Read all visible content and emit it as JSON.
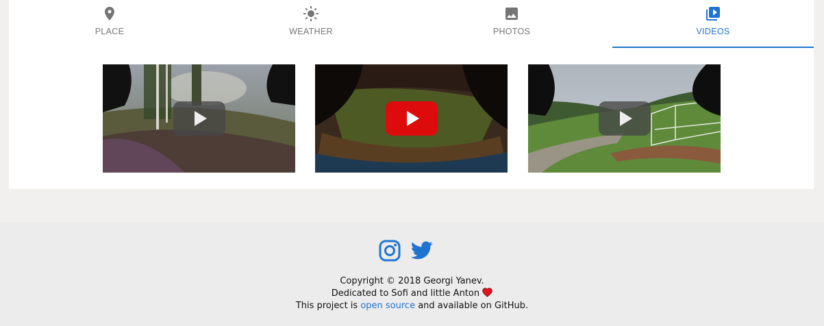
{
  "tabs": [
    {
      "label": "PLACE",
      "icon": "map-pin-icon",
      "active": false
    },
    {
      "label": "WEATHER",
      "icon": "sun-icon",
      "active": false
    },
    {
      "label": "PHOTOS",
      "icon": "image-icon",
      "active": false
    },
    {
      "label": "VIDEOS",
      "icon": "video-library-icon",
      "active": true
    }
  ],
  "videos": [
    {
      "thumbnail": "forest-field-fpv-thumbnail",
      "play_button": "dark"
    },
    {
      "thumbnail": "aerial-field-fpv-thumbnail",
      "play_button": "red"
    },
    {
      "thumbnail": "football-field-fpv-thumbnail",
      "play_button": "dark"
    }
  ],
  "footer": {
    "social": [
      "instagram-icon",
      "twitter-icon"
    ],
    "copyright": "Copyright © 2018 Georgi Yanev.",
    "dedication": "Dedicated to Sofi and little Anton",
    "project_prefix": "This project is",
    "project_link": "open source",
    "project_suffix": "and available on GitHub."
  },
  "colors": {
    "accent": "#1f74cf",
    "inactive_tab": "#757575",
    "youtube_red": "#dd0b0b",
    "heart": "#e0141e",
    "page_bg": "#f1f0ee",
    "footer_bg": "#ececec"
  }
}
